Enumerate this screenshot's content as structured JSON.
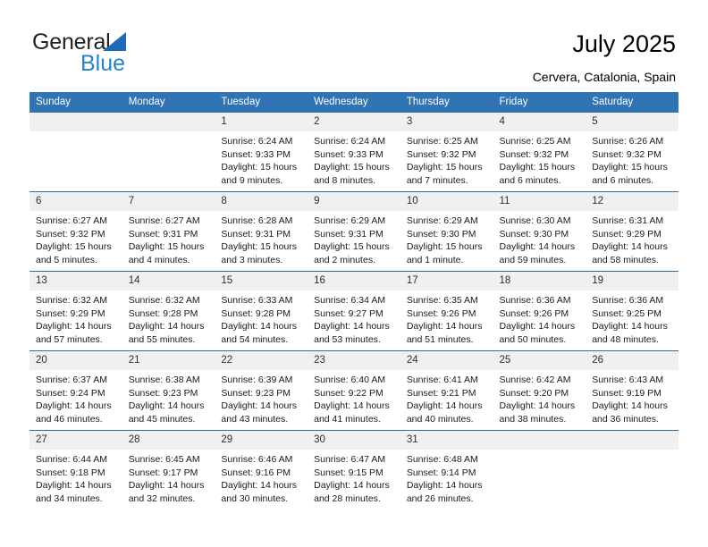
{
  "brand": {
    "name_part1": "General",
    "name_part2": "Blue",
    "triangle_color": "#1c6cb5",
    "text_color": "#231f20",
    "blue_color": "#2484c6"
  },
  "header": {
    "title": "July 2025",
    "subtitle": "Cervera, Catalonia, Spain"
  },
  "calendar": {
    "header_bg": "#3174b4",
    "header_text_color": "#ffffff",
    "daynum_bg": "#f0f0f0",
    "weekday_headers": [
      "Sunday",
      "Monday",
      "Tuesday",
      "Wednesday",
      "Thursday",
      "Friday",
      "Saturday"
    ],
    "labels": {
      "sunrise": "Sunrise:",
      "sunset": "Sunset:",
      "daylight": "Daylight:"
    },
    "weeks": [
      [
        {
          "day": "",
          "empty": true
        },
        {
          "day": "",
          "empty": true
        },
        {
          "day": "1",
          "sunrise": "Sunrise: 6:24 AM",
          "sunset": "Sunset: 9:33 PM",
          "daylight_l1": "Daylight: 15 hours",
          "daylight_l2": "and 9 minutes."
        },
        {
          "day": "2",
          "sunrise": "Sunrise: 6:24 AM",
          "sunset": "Sunset: 9:33 PM",
          "daylight_l1": "Daylight: 15 hours",
          "daylight_l2": "and 8 minutes."
        },
        {
          "day": "3",
          "sunrise": "Sunrise: 6:25 AM",
          "sunset": "Sunset: 9:32 PM",
          "daylight_l1": "Daylight: 15 hours",
          "daylight_l2": "and 7 minutes."
        },
        {
          "day": "4",
          "sunrise": "Sunrise: 6:25 AM",
          "sunset": "Sunset: 9:32 PM",
          "daylight_l1": "Daylight: 15 hours",
          "daylight_l2": "and 6 minutes."
        },
        {
          "day": "5",
          "sunrise": "Sunrise: 6:26 AM",
          "sunset": "Sunset: 9:32 PM",
          "daylight_l1": "Daylight: 15 hours",
          "daylight_l2": "and 6 minutes."
        }
      ],
      [
        {
          "day": "6",
          "sunrise": "Sunrise: 6:27 AM",
          "sunset": "Sunset: 9:32 PM",
          "daylight_l1": "Daylight: 15 hours",
          "daylight_l2": "and 5 minutes."
        },
        {
          "day": "7",
          "sunrise": "Sunrise: 6:27 AM",
          "sunset": "Sunset: 9:31 PM",
          "daylight_l1": "Daylight: 15 hours",
          "daylight_l2": "and 4 minutes."
        },
        {
          "day": "8",
          "sunrise": "Sunrise: 6:28 AM",
          "sunset": "Sunset: 9:31 PM",
          "daylight_l1": "Daylight: 15 hours",
          "daylight_l2": "and 3 minutes."
        },
        {
          "day": "9",
          "sunrise": "Sunrise: 6:29 AM",
          "sunset": "Sunset: 9:31 PM",
          "daylight_l1": "Daylight: 15 hours",
          "daylight_l2": "and 2 minutes."
        },
        {
          "day": "10",
          "sunrise": "Sunrise: 6:29 AM",
          "sunset": "Sunset: 9:30 PM",
          "daylight_l1": "Daylight: 15 hours",
          "daylight_l2": "and 1 minute."
        },
        {
          "day": "11",
          "sunrise": "Sunrise: 6:30 AM",
          "sunset": "Sunset: 9:30 PM",
          "daylight_l1": "Daylight: 14 hours",
          "daylight_l2": "and 59 minutes."
        },
        {
          "day": "12",
          "sunrise": "Sunrise: 6:31 AM",
          "sunset": "Sunset: 9:29 PM",
          "daylight_l1": "Daylight: 14 hours",
          "daylight_l2": "and 58 minutes."
        }
      ],
      [
        {
          "day": "13",
          "sunrise": "Sunrise: 6:32 AM",
          "sunset": "Sunset: 9:29 PM",
          "daylight_l1": "Daylight: 14 hours",
          "daylight_l2": "and 57 minutes."
        },
        {
          "day": "14",
          "sunrise": "Sunrise: 6:32 AM",
          "sunset": "Sunset: 9:28 PM",
          "daylight_l1": "Daylight: 14 hours",
          "daylight_l2": "and 55 minutes."
        },
        {
          "day": "15",
          "sunrise": "Sunrise: 6:33 AM",
          "sunset": "Sunset: 9:28 PM",
          "daylight_l1": "Daylight: 14 hours",
          "daylight_l2": "and 54 minutes."
        },
        {
          "day": "16",
          "sunrise": "Sunrise: 6:34 AM",
          "sunset": "Sunset: 9:27 PM",
          "daylight_l1": "Daylight: 14 hours",
          "daylight_l2": "and 53 minutes."
        },
        {
          "day": "17",
          "sunrise": "Sunrise: 6:35 AM",
          "sunset": "Sunset: 9:26 PM",
          "daylight_l1": "Daylight: 14 hours",
          "daylight_l2": "and 51 minutes."
        },
        {
          "day": "18",
          "sunrise": "Sunrise: 6:36 AM",
          "sunset": "Sunset: 9:26 PM",
          "daylight_l1": "Daylight: 14 hours",
          "daylight_l2": "and 50 minutes."
        },
        {
          "day": "19",
          "sunrise": "Sunrise: 6:36 AM",
          "sunset": "Sunset: 9:25 PM",
          "daylight_l1": "Daylight: 14 hours",
          "daylight_l2": "and 48 minutes."
        }
      ],
      [
        {
          "day": "20",
          "sunrise": "Sunrise: 6:37 AM",
          "sunset": "Sunset: 9:24 PM",
          "daylight_l1": "Daylight: 14 hours",
          "daylight_l2": "and 46 minutes."
        },
        {
          "day": "21",
          "sunrise": "Sunrise: 6:38 AM",
          "sunset": "Sunset: 9:23 PM",
          "daylight_l1": "Daylight: 14 hours",
          "daylight_l2": "and 45 minutes."
        },
        {
          "day": "22",
          "sunrise": "Sunrise: 6:39 AM",
          "sunset": "Sunset: 9:23 PM",
          "daylight_l1": "Daylight: 14 hours",
          "daylight_l2": "and 43 minutes."
        },
        {
          "day": "23",
          "sunrise": "Sunrise: 6:40 AM",
          "sunset": "Sunset: 9:22 PM",
          "daylight_l1": "Daylight: 14 hours",
          "daylight_l2": "and 41 minutes."
        },
        {
          "day": "24",
          "sunrise": "Sunrise: 6:41 AM",
          "sunset": "Sunset: 9:21 PM",
          "daylight_l1": "Daylight: 14 hours",
          "daylight_l2": "and 40 minutes."
        },
        {
          "day": "25",
          "sunrise": "Sunrise: 6:42 AM",
          "sunset": "Sunset: 9:20 PM",
          "daylight_l1": "Daylight: 14 hours",
          "daylight_l2": "and 38 minutes."
        },
        {
          "day": "26",
          "sunrise": "Sunrise: 6:43 AM",
          "sunset": "Sunset: 9:19 PM",
          "daylight_l1": "Daylight: 14 hours",
          "daylight_l2": "and 36 minutes."
        }
      ],
      [
        {
          "day": "27",
          "sunrise": "Sunrise: 6:44 AM",
          "sunset": "Sunset: 9:18 PM",
          "daylight_l1": "Daylight: 14 hours",
          "daylight_l2": "and 34 minutes."
        },
        {
          "day": "28",
          "sunrise": "Sunrise: 6:45 AM",
          "sunset": "Sunset: 9:17 PM",
          "daylight_l1": "Daylight: 14 hours",
          "daylight_l2": "and 32 minutes."
        },
        {
          "day": "29",
          "sunrise": "Sunrise: 6:46 AM",
          "sunset": "Sunset: 9:16 PM",
          "daylight_l1": "Daylight: 14 hours",
          "daylight_l2": "and 30 minutes."
        },
        {
          "day": "30",
          "sunrise": "Sunrise: 6:47 AM",
          "sunset": "Sunset: 9:15 PM",
          "daylight_l1": "Daylight: 14 hours",
          "daylight_l2": "and 28 minutes."
        },
        {
          "day": "31",
          "sunrise": "Sunrise: 6:48 AM",
          "sunset": "Sunset: 9:14 PM",
          "daylight_l1": "Daylight: 14 hours",
          "daylight_l2": "and 26 minutes."
        },
        {
          "day": "",
          "empty": true
        },
        {
          "day": "",
          "empty": true
        }
      ]
    ]
  }
}
